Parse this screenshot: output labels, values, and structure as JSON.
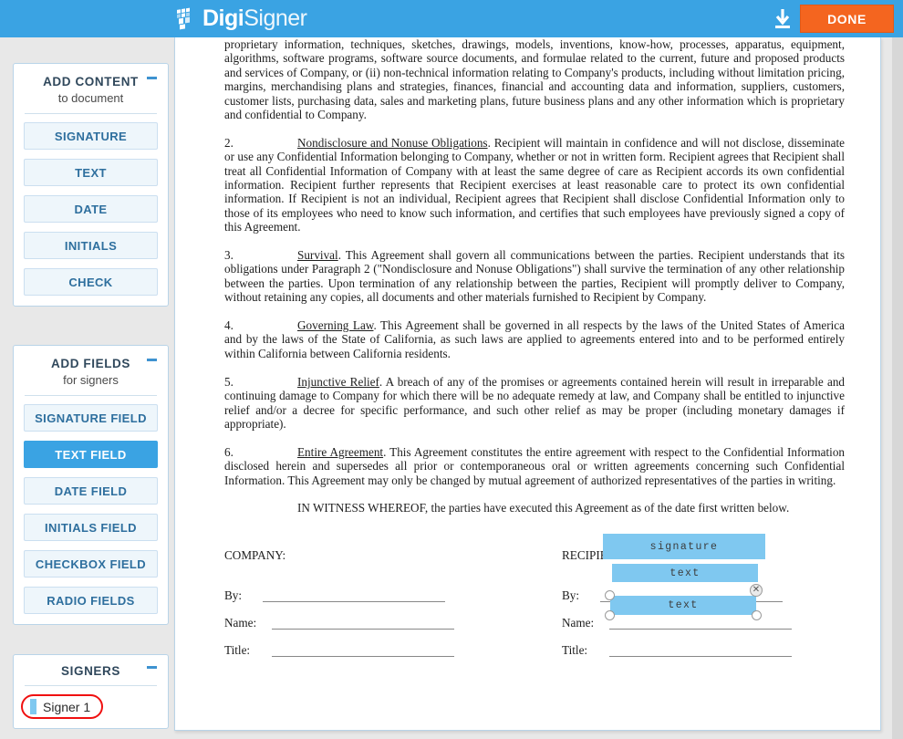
{
  "app": {
    "brand_bold": "Digi",
    "brand_light": "Signer",
    "brand_color": "#3aa3e3",
    "accent_orange": "#f4651f",
    "field_blue": "#7fc8f0",
    "highlight_red": "#f01010"
  },
  "topbar": {
    "download_icon": "download-icon",
    "done_label": "DONE"
  },
  "sidebar": {
    "panels": [
      {
        "title": "ADD CONTENT",
        "subtitle": "to document",
        "collapse_icon": "minus-icon",
        "buttons": [
          {
            "label": "SIGNATURE",
            "active": false
          },
          {
            "label": "TEXT",
            "active": false
          },
          {
            "label": "DATE",
            "active": false
          },
          {
            "label": "INITIALS",
            "active": false
          },
          {
            "label": "CHECK",
            "active": false
          }
        ]
      },
      {
        "title": "ADD FIELDS",
        "subtitle": "for signers",
        "collapse_icon": "minus-icon",
        "buttons": [
          {
            "label": "SIGNATURE FIELD",
            "active": false
          },
          {
            "label": "TEXT FIELD",
            "active": true
          },
          {
            "label": "DATE FIELD",
            "active": false
          },
          {
            "label": "INITIALS FIELD",
            "active": false
          },
          {
            "label": "CHECKBOX FIELD",
            "active": false
          },
          {
            "label": "RADIO FIELDS",
            "active": false
          }
        ]
      },
      {
        "title": "SIGNERS",
        "subtitle": "",
        "collapse_icon": "minus-icon",
        "signers": [
          {
            "label": "Signer 1",
            "chip_color": "#7fc8f0",
            "highlighted": true
          }
        ]
      }
    ]
  },
  "document": {
    "paragraphs": [
      {
        "id": "p1-continued",
        "number": "",
        "heading": "",
        "text": "proprietary information, techniques, sketches, drawings, models, inventions, know-how, processes, apparatus, equipment, algorithms, software programs, software source documents, and formulae related to the current, future and proposed products and services of Company, or (ii) non-technical information relating to Company's products, including without limitation pricing, margins, merchandising plans and strategies, finances, financial and accounting data and information, suppliers, customers, customer lists, purchasing data, sales and marketing plans, future business plans and any other information which is proprietary and confidential to Company."
      },
      {
        "id": "p2",
        "number": "2.",
        "heading": "Nondisclosure and Nonuse Obligations",
        "text": ". Recipient will maintain in confidence and will not disclose, disseminate or use any Confidential Information belonging to Company, whether or not in written form.  Recipient agrees that Recipient shall treat all Confidential Information of Company with at least the same degree of care as Recipient accords its own confidential information.  Recipient further represents that Recipient exercises at least reasonable care to protect its own confidential information.  If Recipient is not an individual, Recipient agrees that Recipient shall disclose Confidential Information only to those of its employees who need to know such information, and certifies that such employees have previously signed a copy of this Agreement."
      },
      {
        "id": "p3",
        "number": "3.",
        "heading": "Survival",
        "text": ".  This Agreement shall govern all communications between the parties.  Recipient understands that its obligations under Paragraph 2 (\"Nondisclosure and Nonuse Obligations\") shall survive the termination of any other relationship between the parties.  Upon termination of any relationship between the parties, Recipient will promptly deliver to Company, without retaining any copies, all documents and other materials furnished to Recipient by Company."
      },
      {
        "id": "p4",
        "number": "4.",
        "heading": "Governing Law",
        "text": ".  This Agreement shall be governed in all respects by the laws of the United States of America and by the laws of the State of California, as such laws are applied to agreements entered into and to be performed entirely within California between California residents."
      },
      {
        "id": "p5",
        "number": "5.",
        "heading": "Injunctive Relief",
        "text": ".  A breach of any of the promises or agreements contained herein will result in irreparable and continuing damage to Company for which there will be no adequate remedy at law, and Company shall be entitled to injunctive relief and/or a decree for specific performance, and such other relief as may be proper (including monetary damages if appropriate)."
      },
      {
        "id": "p6",
        "number": "6.",
        "heading": "Entire Agreement",
        "text": ".  This Agreement constitutes the entire agreement with respect to the Confidential Information disclosed herein and supersedes all prior or contemporaneous oral or written agreements concerning such Confidential Information.  This Agreement may only be changed by mutual agreement of authorized representatives of the parties in writing."
      }
    ],
    "witness_line": "IN WITNESS WHEREOF, the parties have executed this Agreement as of the date first written below.",
    "signature_block": {
      "company": {
        "heading": "COMPANY:",
        "rows": [
          {
            "label": "By:"
          },
          {
            "label": "Name:"
          },
          {
            "label": "Title:"
          }
        ]
      },
      "recipient": {
        "heading": "RECIPIENT:",
        "rows": [
          {
            "label": "By:"
          },
          {
            "label": "Name:"
          },
          {
            "label": "Title:"
          }
        ],
        "fields": [
          {
            "id": "signature-field",
            "value": "signature",
            "selected": false
          },
          {
            "id": "name-text-field",
            "value": "text",
            "selected": false
          },
          {
            "id": "title-text-field",
            "value": "text",
            "selected": true,
            "close_icon": "close-icon"
          }
        ]
      }
    }
  }
}
